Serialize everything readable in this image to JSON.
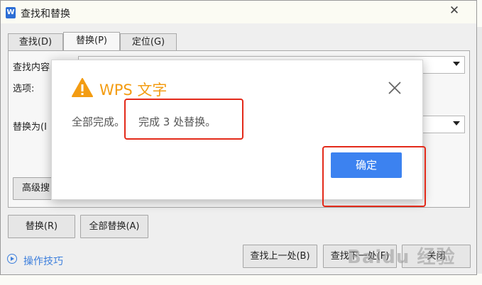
{
  "window": {
    "title": "查找和替换",
    "app_icon_letter": "W",
    "close_glyph": "✕"
  },
  "tabs": [
    {
      "label": "查找(D)"
    },
    {
      "label": "替换(P)",
      "active": true
    },
    {
      "label": "定位(G)"
    }
  ],
  "form": {
    "find_label": "查找内容",
    "options_label": "选项:",
    "replace_label": "替换为(I",
    "advanced_button": "高级搜"
  },
  "buttons": {
    "replace": "替换(R)",
    "replace_all": "全部替换(A)",
    "find_prev": "查找上一处(B)",
    "find_next": "查找下一处(F)",
    "close": "关闭"
  },
  "tips": {
    "label": "操作技巧"
  },
  "message": {
    "title": "WPS 文字",
    "text_prefix": "全部完成。",
    "text_highlight": "完成 3 处替换。",
    "ok_button": "确定"
  },
  "watermark": "Baidu 经验",
  "colors": {
    "accent_blue": "#3c82f0",
    "warning_orange": "#f39c12",
    "annotation_red": "#e32a1a",
    "link_blue": "#3d7fdc"
  }
}
